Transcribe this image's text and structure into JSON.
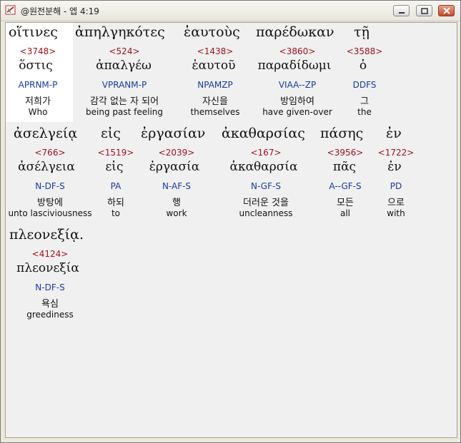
{
  "window": {
    "title": "@원전분해 - 엡 4:19",
    "buttons": [
      "minimize",
      "maximize",
      "close"
    ]
  },
  "rows": [
    {
      "words": [
        {
          "surface": "οἵτινες",
          "strong": "<3748>",
          "lemma": "ὅστις",
          "parse": "APRNM-P",
          "korean": "저희가",
          "english": "Who"
        },
        {
          "surface": "ἀπηλγηκότες",
          "strong": "<524>",
          "lemma": "ἀπαλγέω",
          "parse": "VPRANM-P",
          "korean": "감각 없는 자 되어",
          "english": "being past feeling"
        },
        {
          "surface": "ἑαυτοὺς",
          "strong": "<1438>",
          "lemma": "ἑαυτοῦ",
          "parse": "NPAMZP",
          "korean": "자신을",
          "english": "themselves"
        },
        {
          "surface": "παρέδωκαν",
          "strong": "<3860>",
          "lemma": "παραδίδωμι",
          "parse": "VIAA--ZP",
          "korean": "방임하여",
          "english": "have given-over"
        },
        {
          "surface": "τῇ",
          "strong": "<3588>",
          "lemma": "ὁ",
          "parse": "DDFS",
          "korean": "그",
          "english": "the"
        }
      ]
    },
    {
      "words": [
        {
          "surface": "ἀσελγείᾳ",
          "strong": "<766>",
          "lemma": "ἀσέλγεια",
          "parse": "N-DF-S",
          "korean": "방탕에",
          "english": "unto lasciviousness"
        },
        {
          "surface": "εἰς",
          "strong": "<1519>",
          "lemma": "εἰς",
          "parse": "PA",
          "korean": "하되",
          "english": "to"
        },
        {
          "surface": "ἐργασίαν",
          "strong": "<2039>",
          "lemma": "ἐργασία",
          "parse": "N-AF-S",
          "korean": "행",
          "english": "work"
        },
        {
          "surface": "ἀκαθαρσίας",
          "strong": "<167>",
          "lemma": "ἀκαθαρσία",
          "parse": "N-GF-S",
          "korean": "더러운 것을",
          "english": "uncleanness"
        },
        {
          "surface": "πάσης",
          "strong": "<3956>",
          "lemma": "πᾶς",
          "parse": "A--GF-S",
          "korean": "모든",
          "english": "all"
        },
        {
          "surface": "ἐν",
          "strong": "<1722>",
          "lemma": "ἐν",
          "parse": "PD",
          "korean": "으로",
          "english": "with"
        }
      ]
    },
    {
      "words": [
        {
          "surface": "πλεονεξίᾳ.",
          "strong": "<4124>",
          "lemma": "πλεονεξία",
          "parse": "N-DF-S",
          "korean": "욕심",
          "english": "greediness"
        }
      ]
    }
  ]
}
